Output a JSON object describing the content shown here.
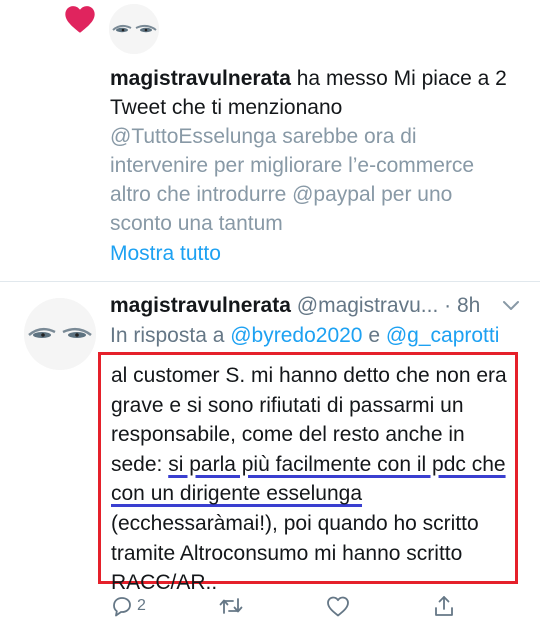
{
  "notification": {
    "icon": "heart-icon",
    "heart_color": "#e0245e",
    "username": "magistravulnerata",
    "action_text": " ha messo Mi piace a 2 Tweet che ti menzionano",
    "quote_text": "@TuttoEsselunga sarebbe ora di intervenire per migliorare l’e-commerce altro che introdurre @paypal per uno sconto una tantum",
    "show_all_label": "Mostra tutto"
  },
  "tweet": {
    "name": "magistravulnerata",
    "handle": "@magistravu...",
    "separator": " · ",
    "time": "8h",
    "reply_prefix": "In risposta a ",
    "reply_mention_1": "@byredo2020",
    "reply_joiner": " e ",
    "reply_mention_2": "@g_caprotti",
    "body_part_1": "al customer S. mi hanno detto che non era grave e si sono rifiutati di passarmi un responsabile, come del resto anche in sede: ",
    "body_underlined": "si parla più facilmente con il pdc che con un dirigente esselunga",
    "body_part_2": " (ecchessaràmai!), poi quando ho scritto tramite Altroconsumo mi hanno scritto RACC/AR..",
    "highlight_color": "#e5202a",
    "underline_color": "#3a3fd0"
  },
  "actions": {
    "reply_icon": "reply-icon",
    "reply_count": "2",
    "retweet_icon": "retweet-icon",
    "like_icon": "like-icon",
    "share_icon": "share-icon"
  },
  "colors": {
    "link": "#1da1f2",
    "secondary": "#657786",
    "muted": "#8899a6",
    "divider": "#e1e8ed"
  }
}
